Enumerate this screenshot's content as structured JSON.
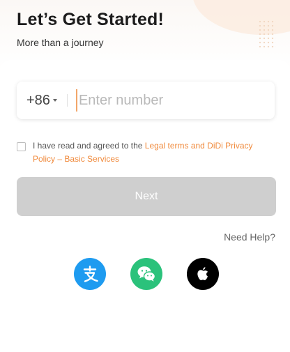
{
  "header": {
    "title": "Let’s Get Started!",
    "subtitle": "More than a journey"
  },
  "phone": {
    "country_code": "+86",
    "input_value": "",
    "placeholder": "Enter number"
  },
  "agreement": {
    "checked": false,
    "text_prefix": "I have read and agreed to the ",
    "link_text": "Legal terms and DiDi Privacy Policy – Basic Services"
  },
  "actions": {
    "next_label": "Next",
    "help_label": "Need Help?"
  },
  "social_login": [
    {
      "icon": "alipay-icon",
      "color": "#1e9bf0"
    },
    {
      "icon": "wechat-icon",
      "color": "#2bc27b"
    },
    {
      "icon": "apple-icon",
      "color": "#000000"
    }
  ],
  "colors": {
    "accent": "#f08a3c",
    "button_disabled": "#cfcfcf"
  }
}
